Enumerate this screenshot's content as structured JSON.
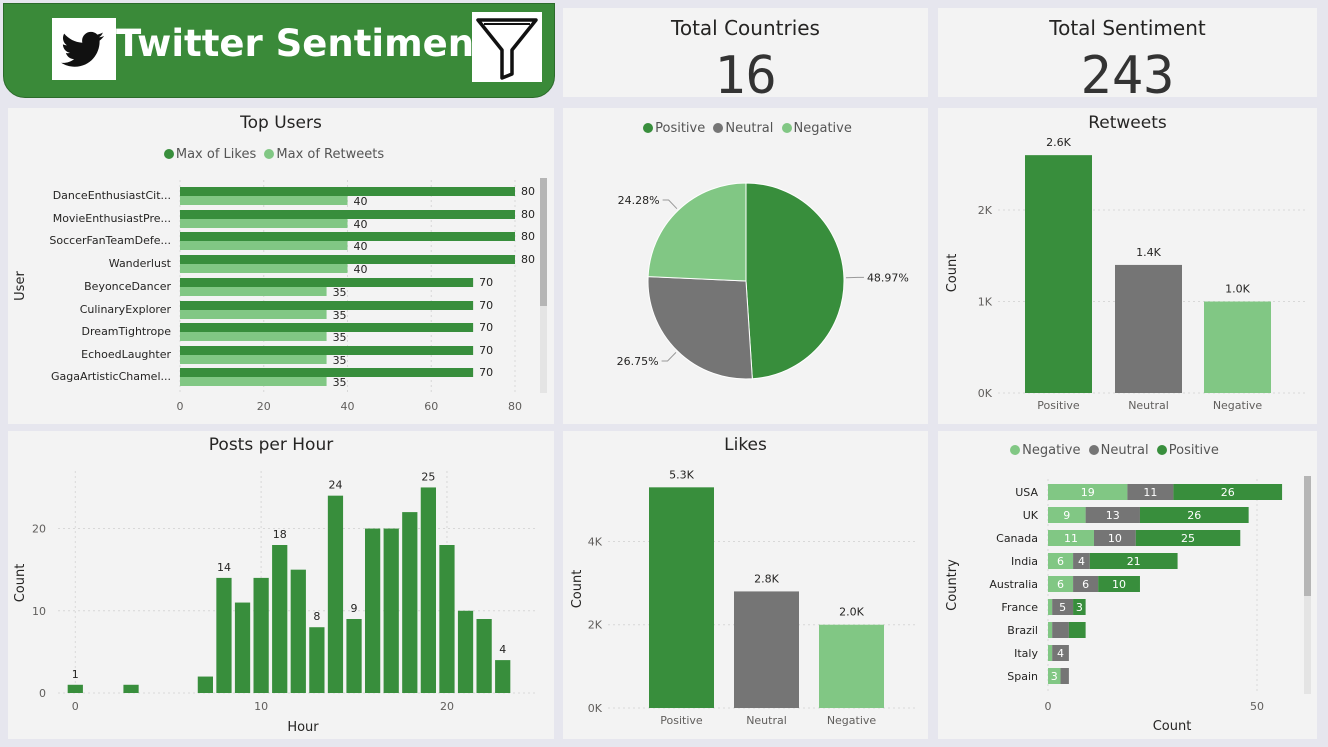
{
  "header": {
    "title": "Twitter Sentiment"
  },
  "kpis": [
    {
      "title": "Total Countries",
      "value": "16"
    },
    {
      "title": "Total Sentiment",
      "value": "243"
    }
  ],
  "colors": {
    "positive": "#388e3c",
    "neutral": "#757575",
    "negative": "#81c784",
    "header_bg": "#3a8a39"
  },
  "top_users": {
    "title": "Top Users",
    "legend": [
      "Max of Likes",
      "Max of Retweets"
    ],
    "ylabel": "User",
    "chart_data": {
      "type": "bar",
      "orientation": "horizontal",
      "categories": [
        "DanceEnthusiastCit...",
        "MovieEnthusiastPre...",
        "SoccerFanTeamDefe...",
        "Wanderlust",
        "BeyonceDancer",
        "CulinaryExplorer",
        "DreamTightrope",
        "EchoedLaughter",
        "GagaArtisticChamel..."
      ],
      "series": [
        {
          "name": "Max of Likes",
          "values": [
            80,
            80,
            80,
            80,
            70,
            70,
            70,
            70,
            70
          ]
        },
        {
          "name": "Max of Retweets",
          "values": [
            40,
            40,
            40,
            40,
            35,
            35,
            35,
            35,
            35
          ]
        }
      ],
      "xlim": [
        0,
        80
      ],
      "xticks": [
        0,
        20,
        40,
        60,
        80
      ]
    }
  },
  "sentiment_pie": {
    "legend": [
      "Positive",
      "Neutral",
      "Negative"
    ],
    "chart_data": {
      "type": "pie",
      "categories": [
        "Positive",
        "Neutral",
        "Negative"
      ],
      "values": [
        48.97,
        26.75,
        24.28
      ],
      "labels": [
        "48.97%",
        "26.75%",
        "24.28%"
      ]
    }
  },
  "retweets": {
    "title": "Retweets",
    "ylabel": "Count",
    "chart_data": {
      "type": "bar",
      "categories": [
        "Positive",
        "Neutral",
        "Negative"
      ],
      "values": [
        2600,
        1400,
        1000
      ],
      "labels": [
        "2.6K",
        "1.4K",
        "1.0K"
      ],
      "ylim": [
        0,
        2700
      ],
      "yticks": [
        0,
        1000,
        2000
      ],
      "ytick_labels": [
        "0K",
        "1K",
        "2K"
      ]
    }
  },
  "posts_per_hour": {
    "title": "Posts per Hour",
    "xlabel": "Hour",
    "ylabel": "Count",
    "chart_data": {
      "type": "bar",
      "x": [
        0,
        3,
        7,
        8,
        9,
        10,
        11,
        12,
        13,
        14,
        15,
        16,
        17,
        18,
        19,
        20,
        21,
        22,
        23
      ],
      "values": [
        1,
        1,
        2,
        14,
        11,
        14,
        18,
        15,
        8,
        24,
        9,
        20,
        20,
        22,
        25,
        18,
        10,
        9,
        4
      ],
      "data_labels": {
        "0": "1",
        "3": "",
        "8": "14",
        "11": "18",
        "13": "8",
        "14": "24",
        "15": "9",
        "19": "25",
        "23": "4"
      },
      "xlim": [
        -0.5,
        23.5
      ],
      "ylim": [
        0,
        27
      ],
      "xticks": [
        0,
        10,
        20
      ],
      "yticks": [
        0,
        10,
        20
      ]
    }
  },
  "likes": {
    "title": "Likes",
    "ylabel": "Count",
    "chart_data": {
      "type": "bar",
      "categories": [
        "Positive",
        "Neutral",
        "Negative"
      ],
      "values": [
        5300,
        2800,
        2000
      ],
      "labels": [
        "5.3K",
        "2.8K",
        "2.0K"
      ],
      "ylim": [
        0,
        5500
      ],
      "yticks": [
        0,
        2000,
        4000
      ],
      "ytick_labels": [
        "0K",
        "2K",
        "4K"
      ]
    }
  },
  "country": {
    "legend": [
      "Negative",
      "Neutral",
      "Positive"
    ],
    "xlabel": "Count",
    "ylabel": "Country",
    "chart_data": {
      "type": "bar",
      "orientation": "horizontal",
      "stacked": true,
      "categories": [
        "USA",
        "UK",
        "Canada",
        "India",
        "Australia",
        "France",
        "Brazil",
        "Italy",
        "Spain"
      ],
      "series": [
        {
          "name": "Negative",
          "values": [
            19,
            9,
            11,
            6,
            6,
            1,
            1,
            1,
            3
          ]
        },
        {
          "name": "Neutral",
          "values": [
            11,
            13,
            10,
            4,
            6,
            5,
            4,
            4,
            2
          ]
        },
        {
          "name": "Positive",
          "values": [
            26,
            26,
            25,
            21,
            10,
            3,
            4,
            0,
            0
          ]
        }
      ],
      "value_labels": {
        "Negative": [
          "19",
          "9",
          "11",
          "6",
          "6",
          "",
          "",
          "",
          "3"
        ],
        "Neutral": [
          "11",
          "13",
          "10",
          "4",
          "6",
          "5",
          "",
          "4",
          ""
        ],
        "Positive": [
          "26",
          "26",
          "25",
          "21",
          "10",
          "3",
          "",
          "",
          ""
        ]
      },
      "xlim": [
        0,
        60
      ],
      "xticks": [
        0,
        50
      ]
    }
  }
}
